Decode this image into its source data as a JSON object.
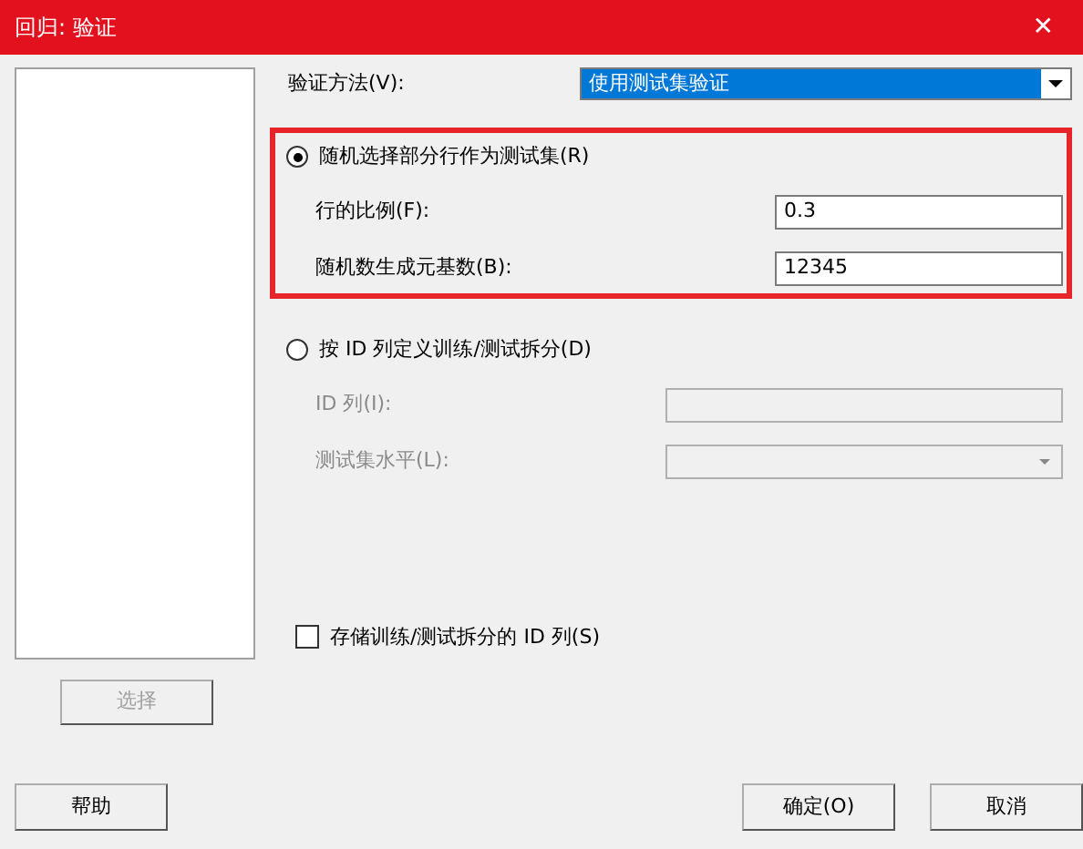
{
  "window": {
    "title": "回归: 验证",
    "close": "✕"
  },
  "method": {
    "label": "验证方法(V):",
    "value": "使用测试集验证"
  },
  "options": [
    {
      "label": "随机选择部分行作为测试集(R)",
      "selected": true,
      "highlighted": true,
      "fields": [
        {
          "kind": "text",
          "label": "行的比例(F):",
          "value": "0.3",
          "disabled": false
        },
        {
          "kind": "text",
          "label": "随机数生成元基数(B):",
          "value": "12345",
          "disabled": false
        }
      ]
    },
    {
      "label": "按 ID 列定义训练/测试拆分(D)",
      "selected": false,
      "highlighted": false,
      "fields": [
        {
          "kind": "text",
          "label": "ID 列(I):",
          "disabled": true
        },
        {
          "kind": "combo",
          "label": "测试集水平(L):",
          "disabled": true
        }
      ]
    }
  ],
  "store": {
    "label": "存储训练/测试拆分的 ID 列(S)",
    "checked": false
  },
  "select_button": {
    "label": "选择",
    "disabled": true
  },
  "buttons": [
    {
      "label": "帮助"
    },
    {
      "label": "确定(O)"
    },
    {
      "label": "取消"
    }
  ]
}
